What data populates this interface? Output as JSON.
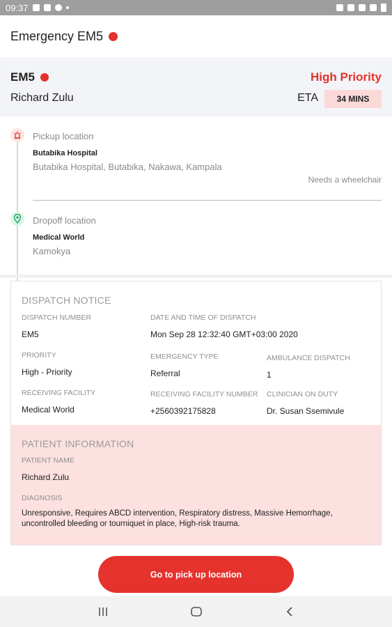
{
  "status_bar": {
    "time": "09:37"
  },
  "app_bar": {
    "title": "Emergency EM5"
  },
  "summary": {
    "code": "EM5",
    "patient_name": "Richard Zulu",
    "priority": "High Priority",
    "eta_label": "ETA",
    "eta_value": "34 MINS"
  },
  "pickup": {
    "label": "Pickup location",
    "place": "Butabika Hospital",
    "address": "Butabika Hospital, Butabika, Nakawa, Kampala",
    "note": "Needs a wheelchair"
  },
  "dropoff": {
    "label": "Dropoff location",
    "place": "Medical World",
    "address": "Kamokya"
  },
  "dispatch": {
    "heading": "DISPATCH NOTICE",
    "dispatch_number_label": "DISPATCH NUMBER",
    "dispatch_number": "EM5",
    "datetime_label": "DATE AND TIME OF DISPATCH",
    "datetime": "Mon Sep 28 12:32:40 GMT+03:00 2020",
    "priority_label": "PRIORITY",
    "priority": "High - Priority",
    "emergency_type_label": "EMERGENCY TYPE",
    "emergency_type": "Referral",
    "ambulance_dispatch_label": "AMBULANCE DISPATCH",
    "ambulance_dispatch": "1",
    "receiving_facility_label": "RECEIVING FACILITY",
    "receiving_facility": "Medical World",
    "facility_number_label": "RECEIVING FACILITY NUMBER",
    "facility_number": "+2560392175828",
    "clinician_label": "CLINICIAN ON DUTY",
    "clinician": "Dr. Susan Ssemivule"
  },
  "patient": {
    "heading": "PATIENT INFORMATION",
    "name_label": "PATIENT NAME",
    "name": "Richard Zulu",
    "diagnosis_label": "DIAGNOSIS",
    "diagnosis": "Unresponsive, Requires ABCD intervention, Respiratory distress, Massive Hemorrhage, uncontrolled bleeding or tourniquet in place, High-risk trauma."
  },
  "cta": {
    "label": "Go to pick up location"
  },
  "colors": {
    "accent": "#e5322d",
    "patient_bg": "#fde0e0",
    "eta_badge_bg": "#fbd9d9"
  },
  "icons": [
    "alarm-icon",
    "location-pin-icon",
    "recents-icon",
    "home-icon",
    "back-icon"
  ]
}
